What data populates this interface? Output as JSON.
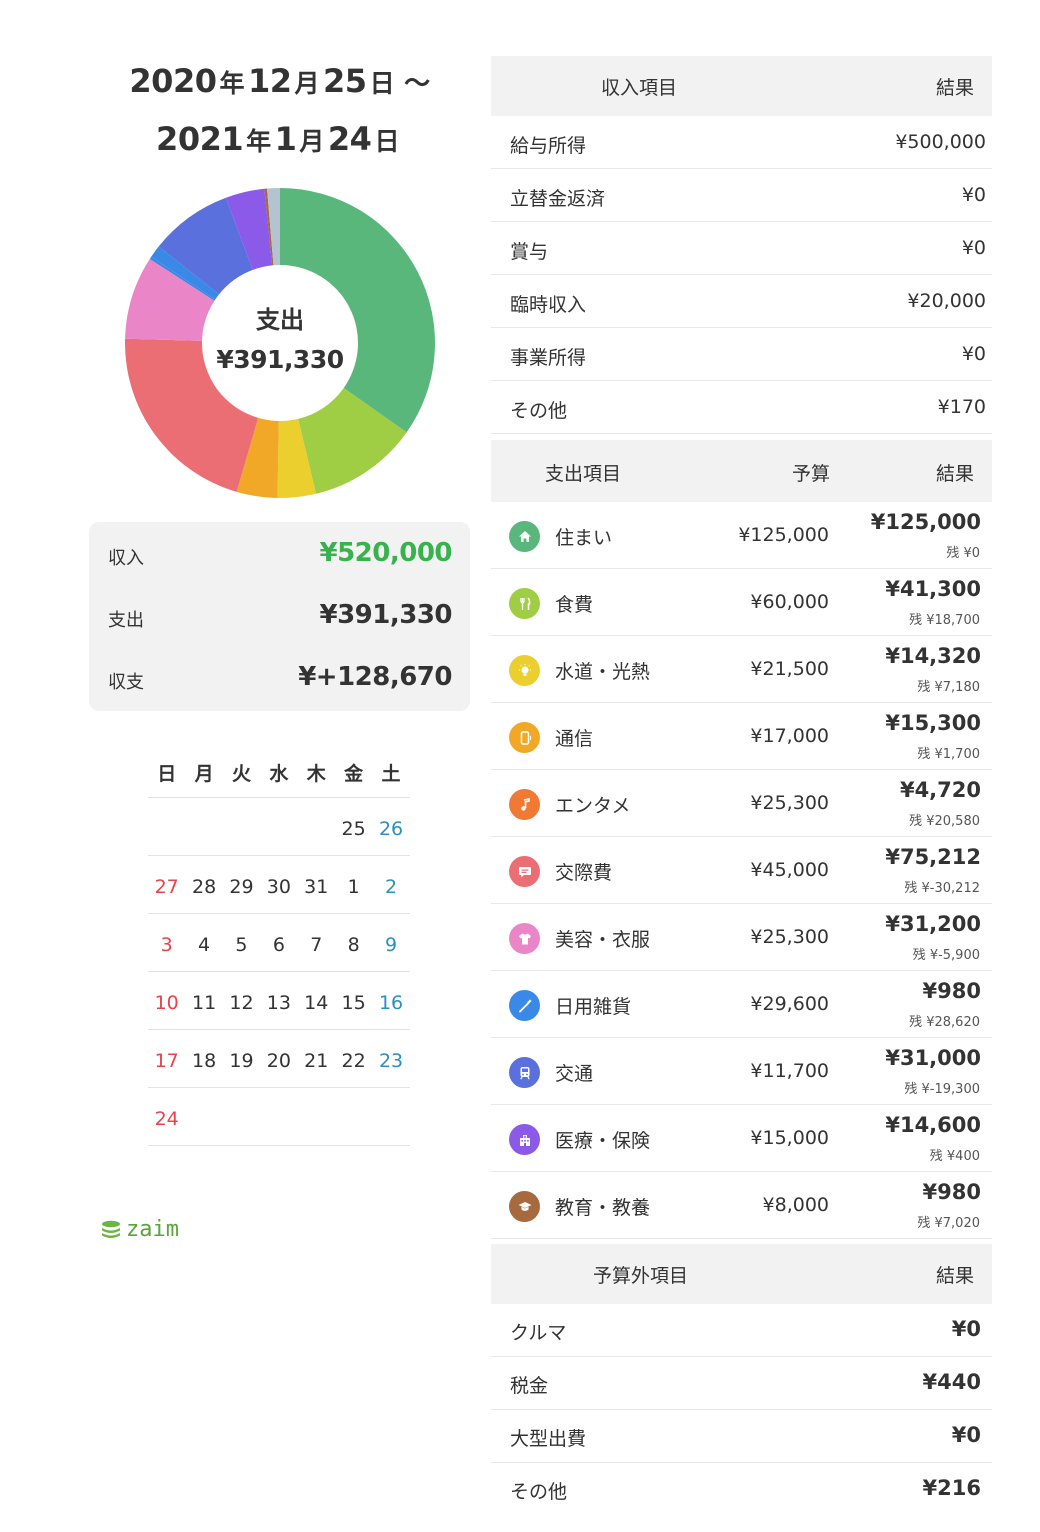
{
  "period": {
    "start": {
      "year": "2020",
      "year_unit": "年",
      "month": "12",
      "month_unit": "月",
      "day": "25",
      "day_unit": "日",
      "tilde": "〜"
    },
    "end": {
      "year": "2021",
      "year_unit": "年",
      "month": "1",
      "month_unit": "月",
      "day": "24",
      "day_unit": "日"
    }
  },
  "donut": {
    "label": "支出",
    "total": "¥391,330",
    "segments": [
      {
        "category": "住まい",
        "value": 125000,
        "color": "#5ab77b"
      },
      {
        "category": "食費",
        "value": 41300,
        "color": "#9fcd44"
      },
      {
        "category": "水道・光熱",
        "value": 14320,
        "color": "#ebcf2e"
      },
      {
        "category": "通信",
        "value": 15300,
        "color": "#f0a826"
      },
      {
        "category": "交際費",
        "value": 75212,
        "color": "#eb6e74"
      },
      {
        "category": "美容・衣服",
        "value": 31200,
        "color": "#ea85c7"
      },
      {
        "category": "日用雑貨",
        "value": 980,
        "color": "#3a89e6"
      },
      {
        "category": "エンタメ",
        "value": 4720,
        "color": "#3a89e6"
      },
      {
        "category": "交通",
        "value": 31000,
        "color": "#5a70dc"
      },
      {
        "category": "医療・保険",
        "value": 14600,
        "color": "#8b5ae8"
      },
      {
        "category": "教育・教養",
        "value": 980,
        "color": "#a66a3e"
      },
      {
        "category": "その他",
        "value": 4800,
        "color": "#b3c3d0"
      }
    ]
  },
  "summary": {
    "income_label": "収入",
    "income_value": "¥520,000",
    "expense_label": "支出",
    "expense_value": "¥391,330",
    "balance_label": "収支",
    "balance_value": "¥+128,670"
  },
  "calendar": {
    "weekdays": [
      "日",
      "月",
      "火",
      "水",
      "木",
      "金",
      "土"
    ],
    "weeks": [
      [
        "",
        "",
        "",
        "",
        "",
        "25",
        "26"
      ],
      [
        "27",
        "28",
        "29",
        "30",
        "31",
        "1",
        "2"
      ],
      [
        "3",
        "4",
        "5",
        "6",
        "7",
        "8",
        "9"
      ],
      [
        "10",
        "11",
        "12",
        "13",
        "14",
        "15",
        "16"
      ],
      [
        "17",
        "18",
        "19",
        "20",
        "21",
        "22",
        "23"
      ],
      [
        "24",
        "",
        "",
        "",
        "",
        "",
        ""
      ]
    ]
  },
  "logo": {
    "text": "zaim",
    "color": "#5aa43a"
  },
  "income_table": {
    "header_item": "収入項目",
    "header_result": "結果",
    "rows": [
      {
        "name": "給与所得",
        "amount": "¥500,000"
      },
      {
        "name": "立替金返済",
        "amount": "¥0"
      },
      {
        "name": "賞与",
        "amount": "¥0"
      },
      {
        "name": "臨時収入",
        "amount": "¥20,000"
      },
      {
        "name": "事業所得",
        "amount": "¥0"
      },
      {
        "name": "その他",
        "amount": "¥170"
      }
    ]
  },
  "expense_table": {
    "header_item": "支出項目",
    "header_budget": "予算",
    "header_result": "結果",
    "rows": [
      {
        "name": "住まい",
        "icon": "house-icon",
        "color": "#5ab77b",
        "budget": "¥125,000",
        "result": "¥125,000",
        "remaining": "残 ¥0"
      },
      {
        "name": "食費",
        "icon": "fork-knife-icon",
        "color": "#9fcd44",
        "budget": "¥60,000",
        "result": "¥41,300",
        "remaining": "残 ¥18,700"
      },
      {
        "name": "水道・光熱",
        "icon": "lightbulb-icon",
        "color": "#ebcf2e",
        "budget": "¥21,500",
        "result": "¥14,320",
        "remaining": "残 ¥7,180"
      },
      {
        "name": "通信",
        "icon": "phone-icon",
        "color": "#f0a826",
        "budget": "¥17,000",
        "result": "¥15,300",
        "remaining": "残 ¥1,700"
      },
      {
        "name": "エンタメ",
        "icon": "music-note-icon",
        "color": "#f07a33",
        "budget": "¥25,300",
        "result": "¥4,720",
        "remaining": "残 ¥20,580"
      },
      {
        "name": "交際費",
        "icon": "chat-bubble-icon",
        "color": "#eb6e74",
        "budget": "¥45,000",
        "result": "¥75,212",
        "remaining": "残 ¥-30,212"
      },
      {
        "name": "美容・衣服",
        "icon": "tshirt-icon",
        "color": "#ea85c7",
        "budget": "¥25,300",
        "result": "¥31,200",
        "remaining": "残 ¥-5,900"
      },
      {
        "name": "日用雑貨",
        "icon": "toothbrush-icon",
        "color": "#3a89e6",
        "budget": "¥29,600",
        "result": "¥980",
        "remaining": "残 ¥28,620"
      },
      {
        "name": "交通",
        "icon": "train-icon",
        "color": "#5a70dc",
        "budget": "¥11,700",
        "result": "¥31,000",
        "remaining": "残 ¥-19,300"
      },
      {
        "name": "医療・保険",
        "icon": "hospital-icon",
        "color": "#8b5ae8",
        "budget": "¥15,000",
        "result": "¥14,600",
        "remaining": "残 ¥400"
      },
      {
        "name": "教育・教養",
        "icon": "graduation-cap-icon",
        "color": "#a66a3e",
        "budget": "¥8,000",
        "result": "¥980",
        "remaining": "残 ¥7,020"
      }
    ]
  },
  "extra_table": {
    "header_item": "予算外項目",
    "header_result": "結果",
    "rows": [
      {
        "name": "クルマ",
        "amount": "¥0"
      },
      {
        "name": "税金",
        "amount": "¥440"
      },
      {
        "name": "大型出費",
        "amount": "¥0"
      },
      {
        "name": "その他",
        "amount": "¥216"
      }
    ]
  }
}
